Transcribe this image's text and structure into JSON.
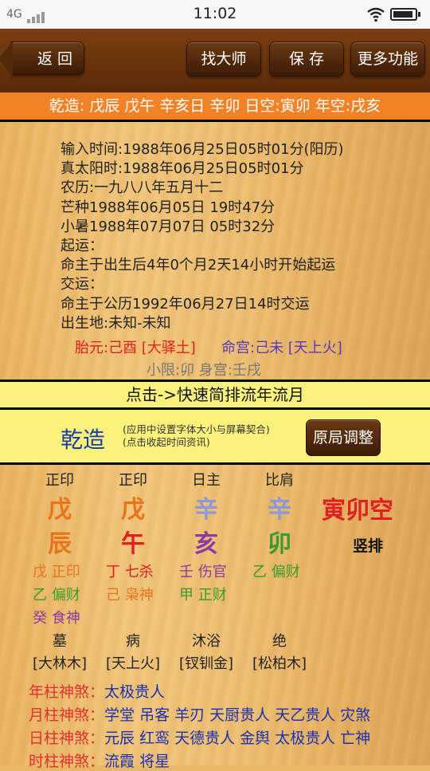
{
  "status": {
    "network": "4G",
    "time": "11:02"
  },
  "toolbar": {
    "back": "返 回",
    "find_master": "找大师",
    "save": "保 存",
    "more": "更多功能"
  },
  "summary_bar": "乾造: 戊辰 戊午 辛亥日 辛卯  日空:寅卯 年空:戌亥",
  "info_lines": [
    "输入时间:1988年06月25日05时01分(阳历)",
    "真太阳时:1988年06月25日05时01分",
    "农历:一九八八年五月十二",
    "芒种1988年06月05日 19时47分",
    "小暑1988年07月07日 05时32分",
    "起运：",
    "命主于出生后4年0个月2天14小时开始起运",
    "交运：",
    "命主于公历1992年06月27日14时交运",
    "出生地:未知-未知"
  ],
  "taiyuan": "胎元:己酉 [大驿土]",
  "minggong": "命宫:己未 [天上火]",
  "xiaoxian": "小限:卯   身宫:壬戌",
  "quick_link": "点击->快速简排流年流月",
  "chart_title": "乾造",
  "chart_note_1": "(应用中设置字体大小与屏幕契合)",
  "chart_note_2": "(点击收起时间资讯)",
  "adjust_button": "原局调整",
  "pillars": [
    {
      "header": "正印",
      "stem": "戊",
      "branch": "辰",
      "stem_color": "#e8741e",
      "branch_color": "#e8741e",
      "hidden": [
        {
          "text": "戊 正印",
          "color": "#e8741e"
        },
        {
          "text": "乙 偏财",
          "color": "#3a9a2a"
        },
        {
          "text": "癸 食神",
          "color": "#8a3aa0"
        }
      ],
      "stage": "墓",
      "nayin": "[大林木]"
    },
    {
      "header": "正印",
      "stem": "戊",
      "branch": "午",
      "stem_color": "#e8741e",
      "branch_color": "#e02020",
      "hidden": [
        {
          "text": "丁 七杀",
          "color": "#e02020"
        },
        {
          "text": "己 枭神",
          "color": "#e8741e"
        }
      ],
      "stage": "病",
      "nayin": "[天上火]"
    },
    {
      "header": "日主",
      "stem": "辛",
      "branch": "亥",
      "stem_color": "#8a9ad8",
      "branch_color": "#8a3aa0",
      "hidden": [
        {
          "text": "壬 伤官",
          "color": "#8a3aa0"
        },
        {
          "text": "甲 正财",
          "color": "#3a9a2a"
        }
      ],
      "stage": "沐浴",
      "nayin": "[钗钏金]"
    },
    {
      "header": "比肩",
      "stem": "辛",
      "branch": "卯",
      "stem_color": "#8a9ad8",
      "branch_color": "#3a9a2a",
      "hidden": [
        {
          "text": "乙 偏财",
          "color": "#3a9a2a"
        }
      ],
      "stage": "绝",
      "nayin": "[松柏木]"
    }
  ],
  "kong": "寅卯空",
  "vertical_label": "竖排",
  "shensha": [
    {
      "key": "年柱神煞",
      "value": "太极贵人"
    },
    {
      "key": "月柱神煞",
      "value": "学堂  吊客  羊刃  天厨贵人  天乙贵人  灾煞"
    },
    {
      "key": "日柱神煞",
      "value": "元辰  红鸾  天德贵人  金舆  太极贵人  亡神"
    },
    {
      "key": "时柱神煞",
      "value": "流霞  将星"
    }
  ]
}
